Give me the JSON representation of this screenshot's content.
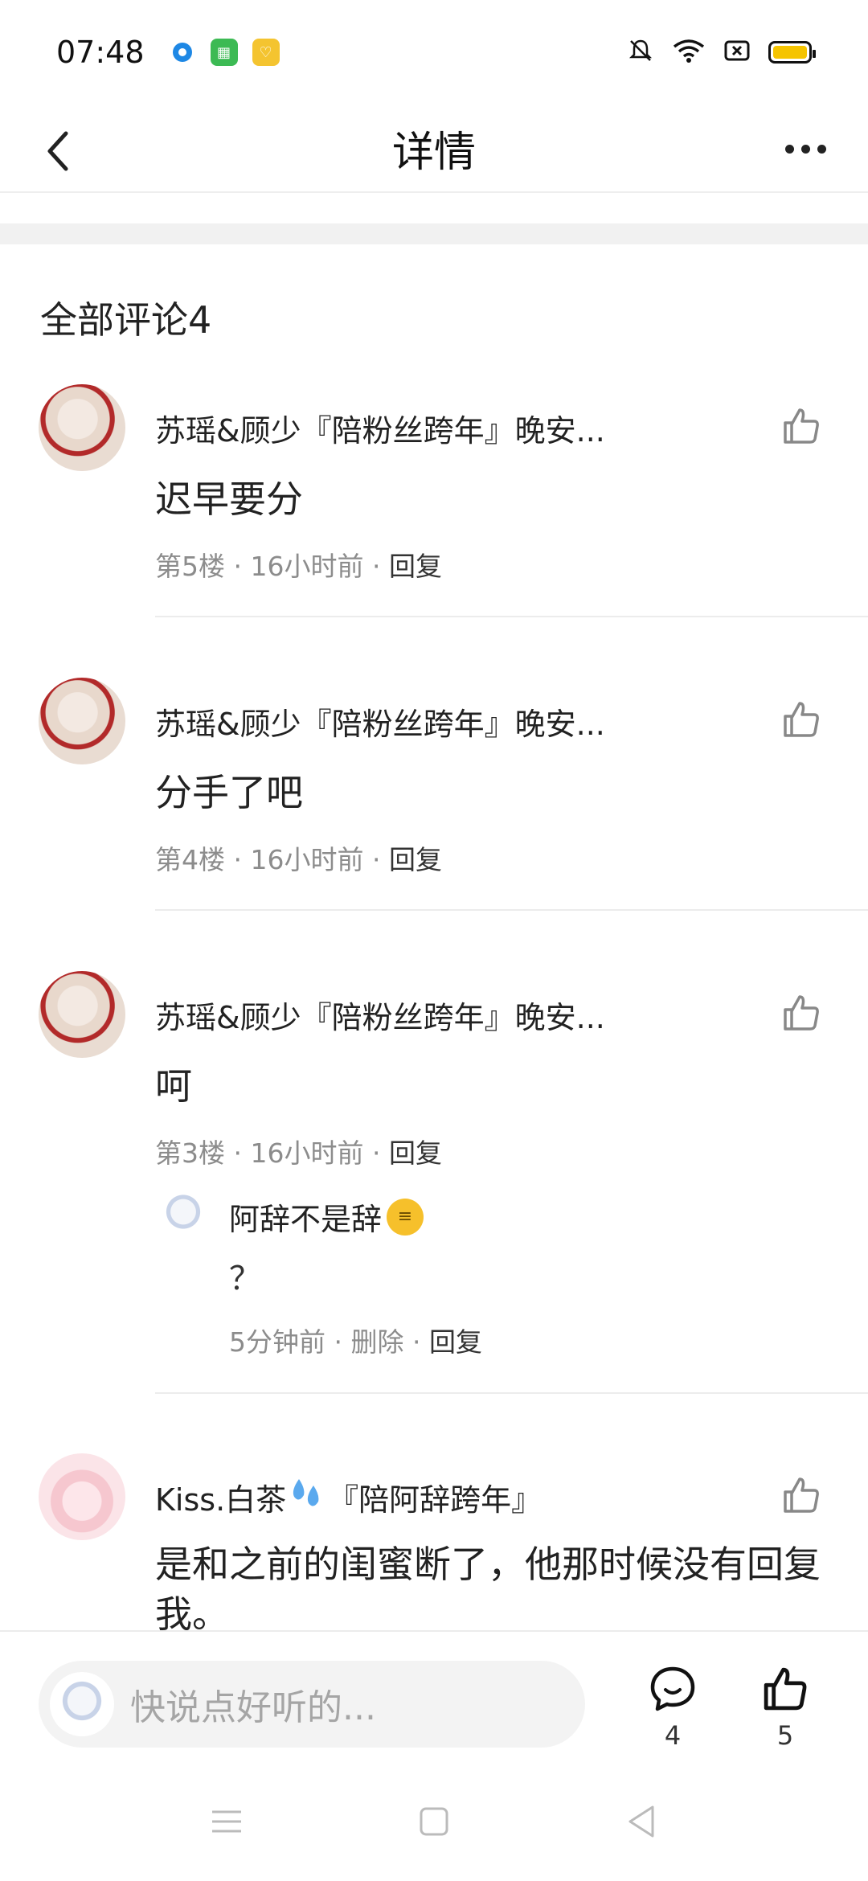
{
  "status_bar": {
    "time": "07:48",
    "app_icons": [
      "browser-icon",
      "app-store-icon",
      "rewards-icon"
    ],
    "right_icons": [
      "mute-bell-icon",
      "wifi-icon",
      "sim-icon",
      "battery-icon"
    ],
    "colors": {
      "battery": "#f5c400",
      "app1": "#1e88e5",
      "app2": "#3cba54",
      "app3": "#f4c430"
    }
  },
  "nav": {
    "title": "详情",
    "back_icon": "chevron-left-icon",
    "more_icon": "more-dots-icon"
  },
  "section": {
    "title": "全部评论4"
  },
  "comments": [
    {
      "username": "苏瑶&顾少『陪粉丝跨年』晚安...",
      "content": "迟早要分",
      "floor": "第5楼",
      "time": "16小时前",
      "reply": "回复"
    },
    {
      "username": "苏瑶&顾少『陪粉丝跨年』晚安...",
      "content": "分手了吧",
      "floor": "第4楼",
      "time": "16小时前",
      "reply": "回复"
    },
    {
      "username": "苏瑶&顾少『陪粉丝跨年』晚安...",
      "content": "呵",
      "floor": "第3楼",
      "time": "16小时前",
      "reply": "回复",
      "sub_reply": {
        "username": "阿辞不是辞",
        "emoji": "zipper-mouth-face-icon",
        "content": "？",
        "time": "5分钟前",
        "delete": "删除",
        "reply": "回复"
      }
    },
    {
      "username_prefix": "Kiss.白茶",
      "username_emoji": "sweat-droplets-icon",
      "username_suffix": "『陪阿辞跨年』",
      "content": "是和之前的闺蜜断了，他那时候没有回复我。"
    }
  ],
  "bottom_bar": {
    "placeholder": "快说点好听的...",
    "comment_count": "4",
    "like_count": "5"
  },
  "meta_sep": "·"
}
